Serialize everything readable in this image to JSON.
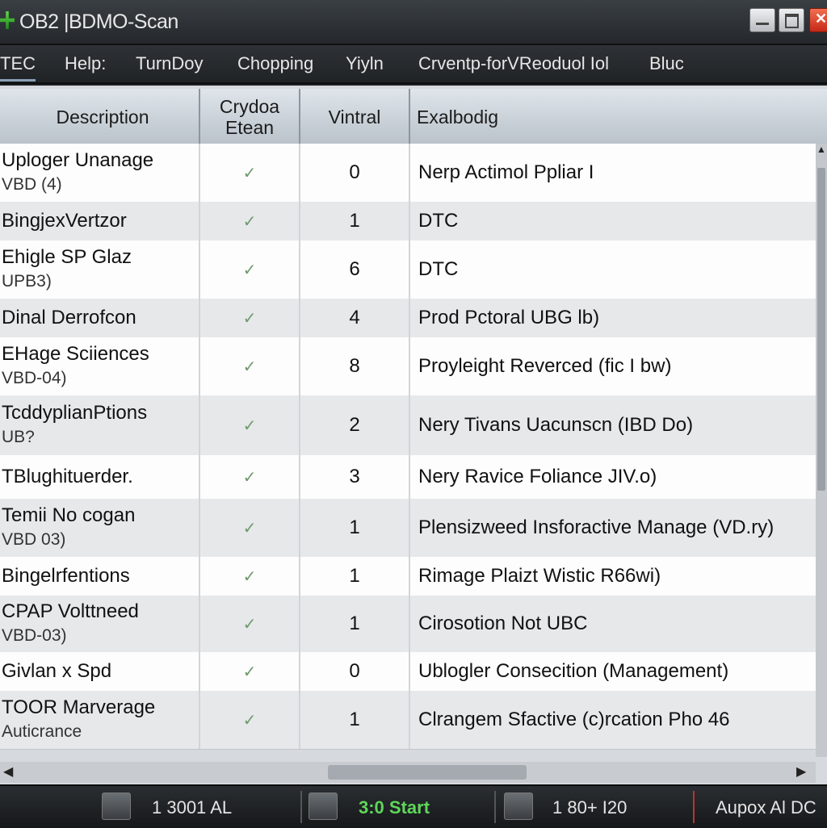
{
  "window": {
    "title": "OB2 |BDMO-Scan",
    "app_icon": "green-cross-icon"
  },
  "menu": [
    "TEC",
    "Help:",
    "TurnDoy",
    "Chopping",
    "Yiyln",
    "Crventp-forVReoduol Iol",
    "Bluc"
  ],
  "table": {
    "headers": {
      "description": "Description",
      "crydoa": "Crydoa Etean",
      "vintral": "Vintral",
      "exalbodig": "Exalbodig"
    },
    "rows": [
      {
        "desc": "Uploger Unanage",
        "sub": "VBD (4)",
        "check": "✓",
        "num": "0",
        "text": "Nerp Actimol Ppliar I"
      },
      {
        "desc": "BingjexVertzor",
        "sub": "",
        "check": "✓",
        "num": "1",
        "text": "DTC"
      },
      {
        "desc": "Ehigle SP Glaz",
        "sub": "UPB3)",
        "check": "✓",
        "num": "6",
        "text": "DTC"
      },
      {
        "desc": "Dinal Derrofcon",
        "sub": "",
        "check": "✓",
        "num": "4",
        "text": "Prod Pctoral UBG lb)"
      },
      {
        "desc": "EHage Sciiences",
        "sub": "VBD-04)",
        "check": "✓",
        "num": "8",
        "text": "Proyleight Reverced (fic I bw)"
      },
      {
        "desc": "TcddyplianPtions",
        "sub": "UB?",
        "check": "✓",
        "num": "2",
        "text": "Nery Tivans Uacunscn (IBD Do)"
      },
      {
        "desc": "TBlughituerder.",
        "sub": "",
        "check": "✓",
        "num": "3",
        "text": "Nery Ravice Foliance JIV.o)"
      },
      {
        "desc": "Temii No cogan",
        "sub": "VBD 03)",
        "check": "✓",
        "num": "1",
        "text": "Plensizweed Insforactive Manage (VD.ry)"
      },
      {
        "desc": "Bingelrfentions",
        "sub": "",
        "check": "✓",
        "num": "1",
        "text": "Rimage Plaizt Wistic R66wi)"
      },
      {
        "desc": "CPAP Volttneed",
        "sub": "VBD-03)",
        "check": "✓",
        "num": "1",
        "text": "Cirosotion Not UBC"
      },
      {
        "desc": "Givlan x Spd",
        "sub": "",
        "check": "✓",
        "num": "0",
        "text": "Ublogler Consecition (Management)"
      },
      {
        "desc": "TOOR Marverage",
        "sub": "Auticrance",
        "check": "✓",
        "num": "1",
        "text": "Clrangem Sfactive (c)rcation Pho 46"
      }
    ]
  },
  "statusbar": {
    "field1": "1 3001 AL",
    "start": "3:0 Start",
    "field3": "1 80+ I20",
    "field4": "Aupox Al DC"
  }
}
